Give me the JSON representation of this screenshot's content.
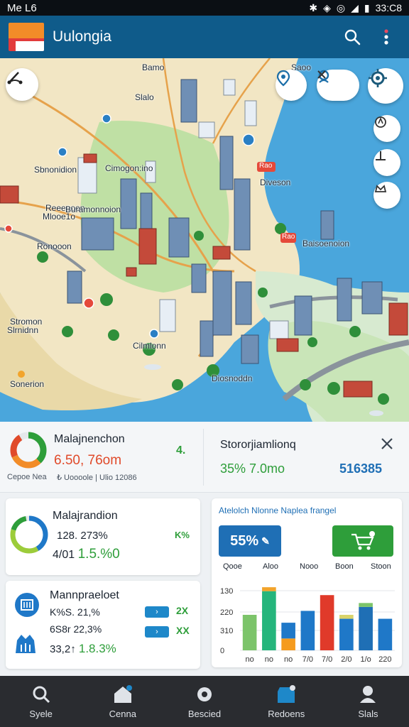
{
  "status_bar": {
    "left": "Me L6",
    "time": "33:C8"
  },
  "app": {
    "title": "Uulongia"
  },
  "map": {
    "labels": [
      "Bamo",
      "Slalo",
      "Saoo",
      "Sbnonidion",
      "Cimogon:ino",
      "Diveson",
      "Reeeooon",
      "Mlooe1o",
      "Ronooon",
      "Slrnidnn",
      "Stromon",
      "Baisoenoion",
      "Sonerion",
      "Cilmlonn",
      "Diosnoddn",
      "Buramonnoion"
    ],
    "poi_badges": [
      "Rao",
      "Rao"
    ]
  },
  "panel_top_left": {
    "title": "Malajnenchon",
    "value_red": "6.50,",
    "value_tail": "76om",
    "sub_left": "Cepoe Nea",
    "sub_right": "₺ Uoooole | Ulio 12086",
    "trend": "4."
  },
  "panel_top_right": {
    "title": "Stororjiamlionq",
    "value_green": "35% 7.0mo",
    "value_blue": "516385",
    "icon": "close-icon"
  },
  "card_a": {
    "title": "Malajrandion",
    "line1": "128. 273%",
    "line2_a": "4/01",
    "line2_b": "1.5.%0",
    "right": "K%"
  },
  "card_b": {
    "title": "Mannpraeloet",
    "line1": "K%S. 21,%",
    "line2": "6S8r 22,3%",
    "line3_a": "33,2↑",
    "line3_b": "1.8.3%",
    "chip1": "2X",
    "chip2": "XX"
  },
  "chart_card": {
    "header": "Atelolch Nlonne Naplea frangel",
    "pill_blue": "55%",
    "labels_top": [
      "Qooe",
      "Aloo",
      "Nooo",
      "Boon",
      "Stoon"
    ]
  },
  "chart_data": {
    "type": "bar",
    "categories": [
      "no",
      "no",
      "no",
      "7/0",
      "7/0",
      "2/0",
      "1/o",
      "220"
    ],
    "yticks": [
      "130",
      "220",
      "310",
      "0"
    ],
    "series": [
      {
        "values": [
          45,
          75,
          15,
          50,
          70,
          40,
          55,
          40
        ]
      },
      {
        "values": [
          0,
          5,
          20,
          0,
          0,
          5,
          5,
          0
        ]
      }
    ],
    "colors": [
      "#7cc46a",
      "#25b57c",
      "#f59b1e",
      "#1f78c8",
      "#e03a2a",
      "#1f78c8",
      "#1f6fb5",
      "#1f78c8"
    ],
    "cap_colors": [
      "",
      "#f2a42b",
      "#1f78c8",
      "",
      "",
      "#d9d36a",
      "#7cc46a",
      ""
    ],
    "ylim": [
      0,
      90
    ]
  },
  "bottom_nav": {
    "items": [
      {
        "label": "Syele",
        "icon": "search-icon"
      },
      {
        "label": "Cenna",
        "icon": "home-icon"
      },
      {
        "label": "Bescied",
        "icon": "settings-icon"
      },
      {
        "label": "Redoens",
        "icon": "shop-icon"
      },
      {
        "label": "Slals",
        "icon": "user-icon"
      }
    ]
  }
}
